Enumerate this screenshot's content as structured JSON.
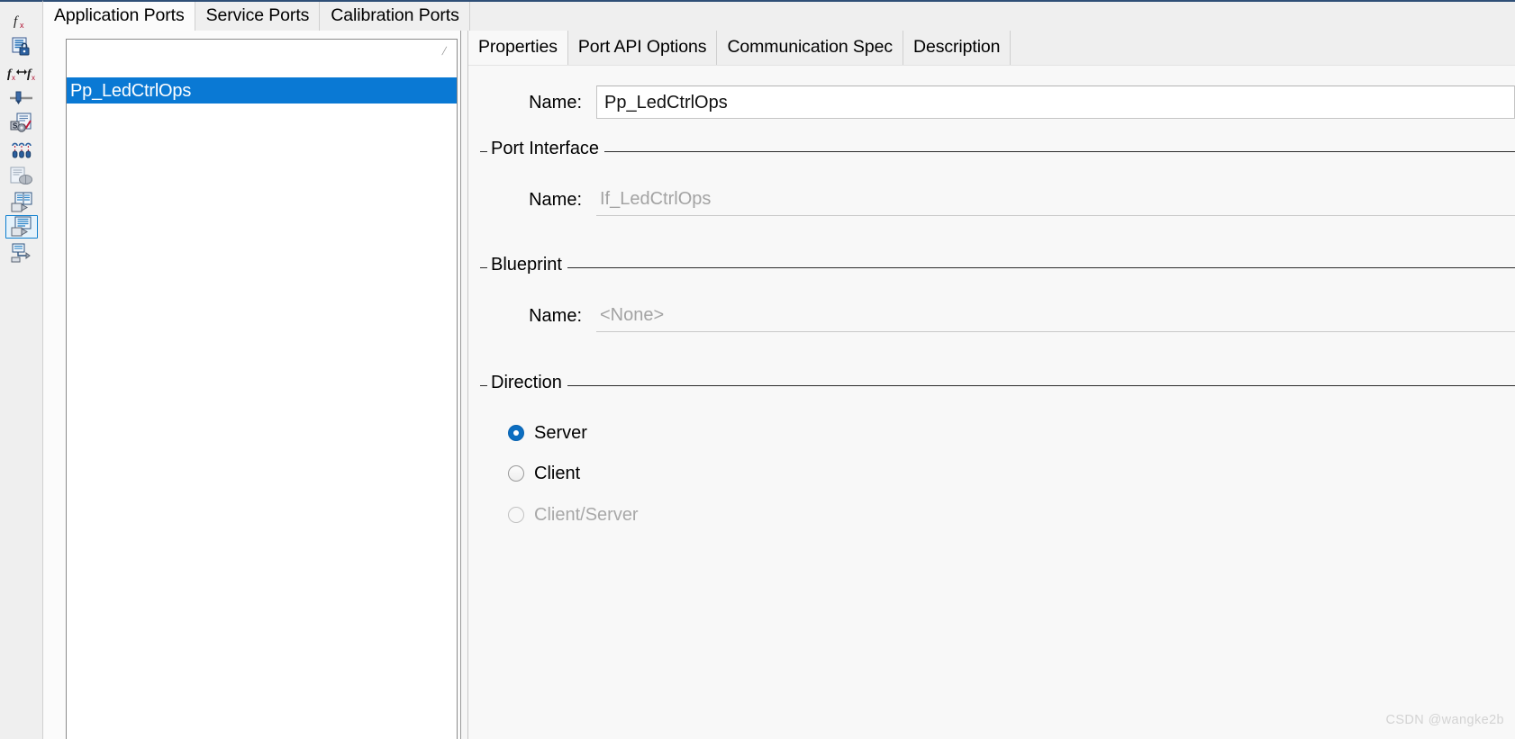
{
  "app": {
    "accent_color": "#0a79d4",
    "panel_bg": "#f8f8f8",
    "strip_bg": "#efefef"
  },
  "icon_strip": {
    "items": [
      {
        "name": "fx-delete-icon",
        "label": ""
      },
      {
        "name": "locked-document-icon",
        "label": ""
      },
      {
        "name": "fx-swap-fx-icon",
        "label": ""
      },
      {
        "name": "pin-slider-icon",
        "label": ""
      },
      {
        "name": "document-check-settings-icon",
        "label": ""
      },
      {
        "name": "three-connectors-icon",
        "label": ""
      },
      {
        "name": "document-package-icon",
        "label": ""
      },
      {
        "name": "table-export-icon",
        "label": ""
      },
      {
        "name": "port-interface-list-icon",
        "label": ""
      },
      {
        "name": "runnable-flow-icon",
        "label": ""
      }
    ],
    "selected_index": 8
  },
  "outer_tabs": {
    "items": [
      {
        "label": "Application Ports"
      },
      {
        "label": "Service Ports"
      },
      {
        "label": "Calibration Ports"
      }
    ],
    "active_index": 0
  },
  "port_list": {
    "marker": "/",
    "items": [
      {
        "label": "Pp_LedCtrlOps",
        "selected": true
      }
    ]
  },
  "inner_tabs": {
    "items": [
      {
        "label": "Properties"
      },
      {
        "label": "Port API Options"
      },
      {
        "label": "Communication Spec"
      },
      {
        "label": "Description"
      }
    ],
    "active_index": 0
  },
  "properties": {
    "name_field": {
      "label": "Name:",
      "value": "Pp_LedCtrlOps",
      "placeholder": ""
    },
    "port_interface": {
      "legend": "Port Interface",
      "name_label": "Name:",
      "name_value": "If_LedCtrlOps"
    },
    "blueprint": {
      "legend": "Blueprint",
      "name_label": "Name:",
      "name_value": "<None>"
    },
    "direction": {
      "legend": "Direction",
      "options": [
        {
          "label": "Server",
          "checked": true,
          "disabled": false
        },
        {
          "label": "Client",
          "checked": false,
          "disabled": false
        },
        {
          "label": "Client/Server",
          "checked": false,
          "disabled": true
        }
      ]
    }
  },
  "watermark": {
    "text": "CSDN @wangke2b"
  }
}
